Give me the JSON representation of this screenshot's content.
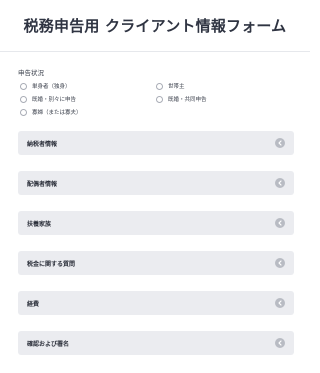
{
  "header": {
    "title": "税務申告用 クライアント情報フォーム"
  },
  "filing_status": {
    "label": "申告状況",
    "options": [
      {
        "label": "単身者（独身）",
        "icon": "radio-unchecked"
      },
      {
        "label": "世帯主",
        "icon": "radio-unchecked"
      },
      {
        "label": "既婚・別々に申告",
        "icon": "radio-unchecked"
      },
      {
        "label": "既婚・共同申告",
        "icon": "radio-unchecked"
      },
      {
        "label": "寡婦（または寡夫）",
        "icon": "radio-unchecked"
      }
    ]
  },
  "sections": [
    {
      "title": "納税者情報",
      "icon": "chevron-left-icon"
    },
    {
      "title": "配偶者情報",
      "icon": "chevron-left-icon"
    },
    {
      "title": "扶養家族",
      "icon": "chevron-left-icon"
    },
    {
      "title": "税金に関する質問",
      "icon": "chevron-left-icon"
    },
    {
      "title": "経費",
      "icon": "chevron-left-icon"
    },
    {
      "title": "確認および署名",
      "icon": "chevron-left-icon"
    }
  ],
  "colors": {
    "section_bg": "#ebecf0",
    "toggle_icon": "#b8bbc3",
    "title_text": "#2f3442"
  }
}
